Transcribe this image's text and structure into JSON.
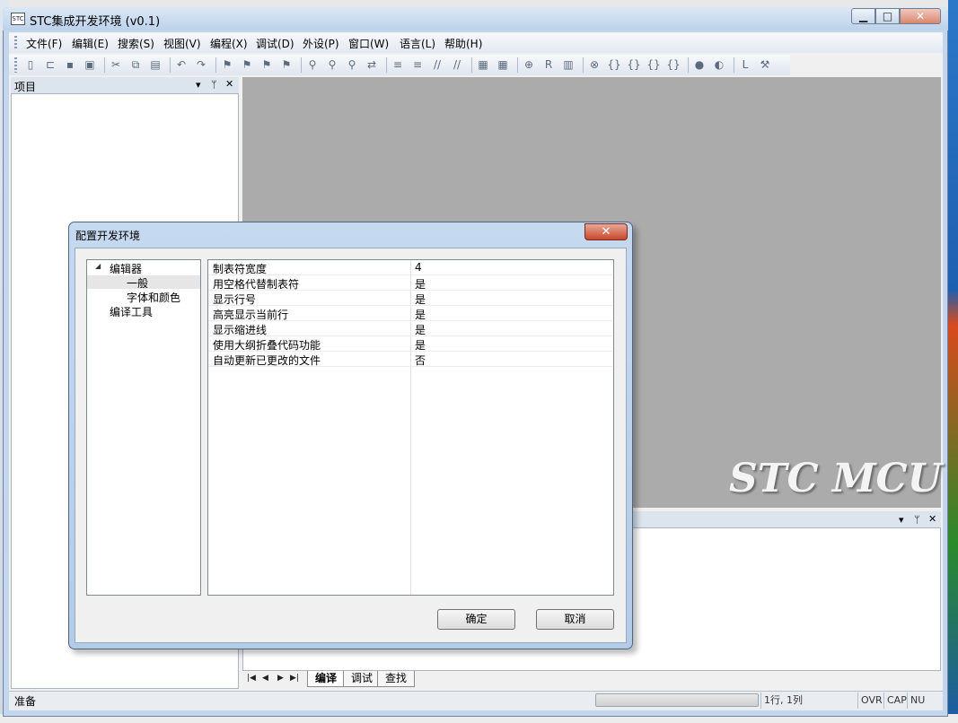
{
  "window": {
    "title": "STC集成开发环境 (v0.1)",
    "icon_text": "STC"
  },
  "caption_buttons": {
    "minimize": "▁",
    "maximize": "□",
    "close": "✕"
  },
  "menubar": {
    "items": [
      "文件(F)",
      "编辑(E)",
      "搜索(S)",
      "视图(V)",
      "编程(X)",
      "调试(D)",
      "外设(P)",
      "窗口(W)",
      "语言(L)",
      "帮助(H)"
    ]
  },
  "toolbar": {
    "icons": [
      "new-file-icon",
      "open-folder-icon",
      "save-icon",
      "save-all-icon",
      "cut-icon",
      "copy-icon",
      "paste-icon",
      "undo-icon",
      "redo-icon",
      "bookmark-toggle-icon",
      "bookmark-next-icon",
      "bookmark-prev-icon",
      "bookmark-clear-icon",
      "find-icon",
      "find-next-icon",
      "find-prev-icon",
      "replace-icon",
      "indent-icon",
      "outdent-icon",
      "comment-icon",
      "uncomment-icon",
      "compile-icon",
      "build-all-icon",
      "zoom-icon",
      "reset-icon",
      "registers-icon",
      "stop-icon",
      "step-into-icon",
      "step-over-icon",
      "step-out-icon",
      "run-to-cursor-icon",
      "breakpoint-icon",
      "clear-breakpoints-icon",
      "load-icon",
      "tools-icon"
    ]
  },
  "project_pane": {
    "title": "项目",
    "pin": "▾",
    "dock": "ᛘ",
    "close": "✕"
  },
  "editor_area": {
    "logo_text": "STC MCU"
  },
  "output_pane": {
    "tabs": [
      "编译",
      "调试",
      "查找"
    ],
    "nav": [
      "|◀",
      "◀",
      "▶",
      "▶|"
    ]
  },
  "statusbar": {
    "status": "准备",
    "position": "1行, 1列",
    "ovr": "OVR",
    "cap": "CAP",
    "num": "NU"
  },
  "dialog": {
    "title": "配置开发环境",
    "close": "✕",
    "tree": {
      "root": "编辑器",
      "children": [
        "一般",
        "字体和颜色"
      ],
      "sibling": "编译工具"
    },
    "properties": [
      {
        "name": "制表符宽度",
        "value": "4"
      },
      {
        "name": "用空格代替制表符",
        "value": "是"
      },
      {
        "name": "显示行号",
        "value": "是"
      },
      {
        "name": "高亮显示当前行",
        "value": "是"
      },
      {
        "name": "显示缩进线",
        "value": "是"
      },
      {
        "name": "使用大纲折叠代码功能",
        "value": "是"
      },
      {
        "name": "自动更新已更改的文件",
        "value": "否"
      }
    ],
    "ok_label": "确定",
    "cancel_label": "取消"
  }
}
